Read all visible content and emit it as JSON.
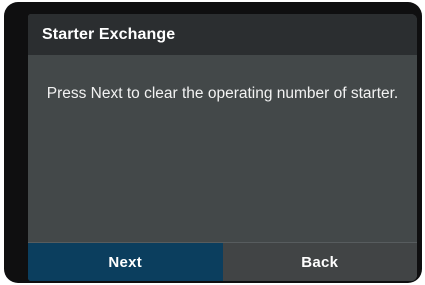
{
  "dialog": {
    "title": "Starter Exchange",
    "message": "Press Next to clear the operating number of starter."
  },
  "buttons": {
    "next_label": "Next",
    "back_label": "Back"
  },
  "colors": {
    "title_bar": "#2b2e30",
    "body": "#434849",
    "next_button": "#0b3e5e",
    "back_button": "#414445",
    "bezel": "#0f0f10"
  }
}
